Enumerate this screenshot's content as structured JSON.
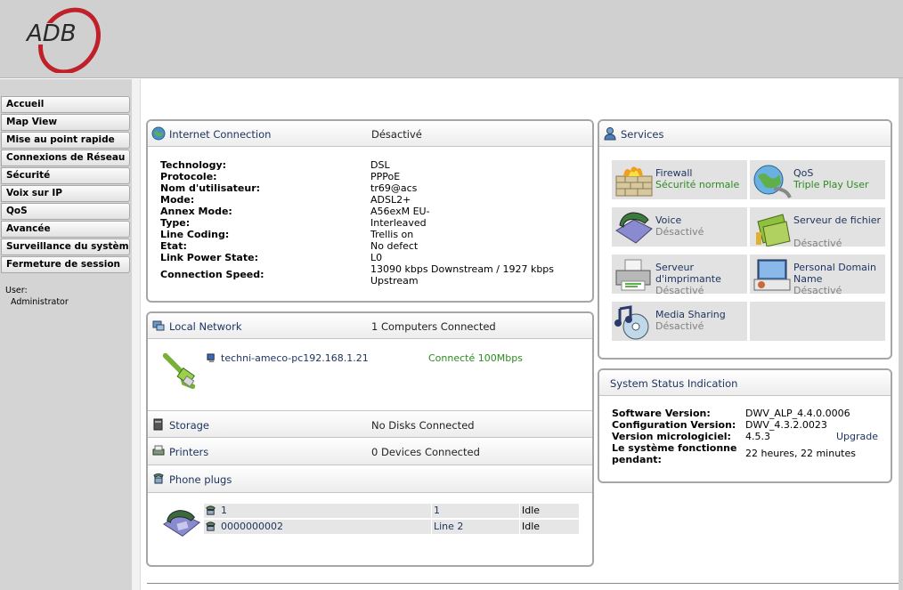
{
  "brand": {
    "logo_text": "ADB",
    "logo_color": "#c0202a"
  },
  "colors": {
    "header_bg": "#d0d0d0",
    "link_blue": "#1e3560",
    "status_green": "#2e8b22",
    "status_grey": "#808080"
  },
  "sidebar": {
    "items": [
      {
        "label": "Accueil"
      },
      {
        "label": "Map View"
      },
      {
        "label": "Mise au point rapide"
      },
      {
        "label": "Connexions de Réseau"
      },
      {
        "label": "Sécurité"
      },
      {
        "label": "Voix sur IP"
      },
      {
        "label": "QoS"
      },
      {
        "label": "Avancée"
      },
      {
        "label": "Surveillance du système"
      },
      {
        "label": "Fermeture de session"
      }
    ],
    "user_label": "User:",
    "user_name": "Administrator"
  },
  "internet": {
    "title": "Internet Connection",
    "status": "Désactivé",
    "rows": [
      {
        "label": "Technology:",
        "value": "DSL"
      },
      {
        "label": "Protocole:",
        "value": "PPPoE"
      },
      {
        "label": "Nom d'utilisateur:",
        "value": "tr69@acs"
      },
      {
        "label": "Mode:",
        "value": "ADSL2+"
      },
      {
        "label": "Annex Mode:",
        "value": "A56exM EU-"
      },
      {
        "label": "Type:",
        "value": "Interleaved"
      },
      {
        "label": "Line Coding:",
        "value": "Trellis on"
      },
      {
        "label": "Etat:",
        "value": "No defect"
      },
      {
        "label": "Link Power State:",
        "value": "L0"
      }
    ],
    "speed_label": "Connection Speed:",
    "speed_line1": "13090 kbps Downstream / 1927 kbps",
    "speed_line2": "Upstream"
  },
  "local_network": {
    "title": "Local Network",
    "summary": "1 Computers Connected",
    "device_name": "techni-ameco-pc192.168.1.21",
    "device_status": "Connecté 100Mbps",
    "storage_title": "Storage",
    "storage_value": "No Disks Connected",
    "printers_title": "Printers",
    "printers_value": "0 Devices Connected",
    "phone_title": "Phone plugs",
    "phones": [
      {
        "number": "1",
        "line": "1",
        "state": "Idle"
      },
      {
        "number": "0000000002",
        "line": "Line 2",
        "state": "Idle"
      }
    ]
  },
  "services": {
    "title": "Services",
    "items": [
      {
        "name": "Firewall",
        "status": "Sécurité normale",
        "icon": "firewall-icon"
      },
      {
        "name": "QoS",
        "status": "Triple Play User",
        "icon": "qos-icon"
      },
      {
        "name": "Voice",
        "status": "Désactivé",
        "icon": "voice-icon"
      },
      {
        "name": "Serveur de fichier",
        "status": "Désactivé",
        "icon": "file-server-icon"
      },
      {
        "name": "Serveur d'imprimante",
        "status": "Désactivé",
        "icon": "printer-server-icon"
      },
      {
        "name": "Personal Domain Name",
        "status": "Désactivé",
        "icon": "domain-name-icon"
      },
      {
        "name": "Media Sharing",
        "status": "Désactivé",
        "icon": "media-sharing-icon"
      }
    ]
  },
  "system_status": {
    "title": "System Status Indication",
    "software_label": "Software Version:",
    "software_value": "DWV_ALP_4.4.0.0006",
    "config_label": "Configuration Version:",
    "config_value": "DWV_4.3.2.0023",
    "firmware_label": "Version micrologiciel:",
    "firmware_value": "4.5.3",
    "upgrade_label": "Upgrade",
    "uptime_label_1": "Le système fonctionne",
    "uptime_label_2": "pendant:",
    "uptime_value": "22 heures, 22 minutes"
  }
}
